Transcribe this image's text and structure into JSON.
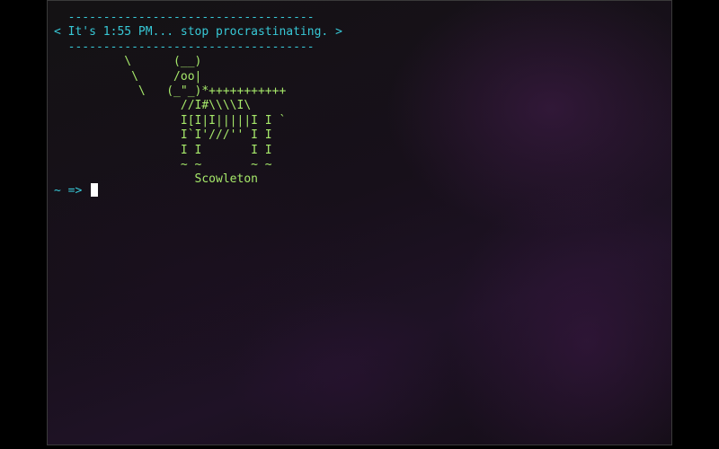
{
  "terminal": {
    "banner": {
      "top_rule": "  -----------------------------------",
      "message": "< It's 1:55 PM... stop procrastinating. >",
      "bottom_rule": "  -----------------------------------"
    },
    "art_lines": [
      "          \\      (__)",
      "           \\     /oo|",
      "            \\   (_\"_)*+++++++++++",
      "                  //I#\\\\\\\\I\\",
      "                  I[I|I|||||I I `",
      "                  I`I'///'' I I",
      "                  I I       I I",
      "                  ~ ~       ~ ~",
      "                    Scowleton"
    ],
    "prompt": {
      "symbol": "~ =>",
      "input_value": ""
    }
  },
  "colors": {
    "banner": "#37c8d6",
    "art": "#a6e86a",
    "prompt": "#37c8d6",
    "cursor": "#ffffff"
  }
}
